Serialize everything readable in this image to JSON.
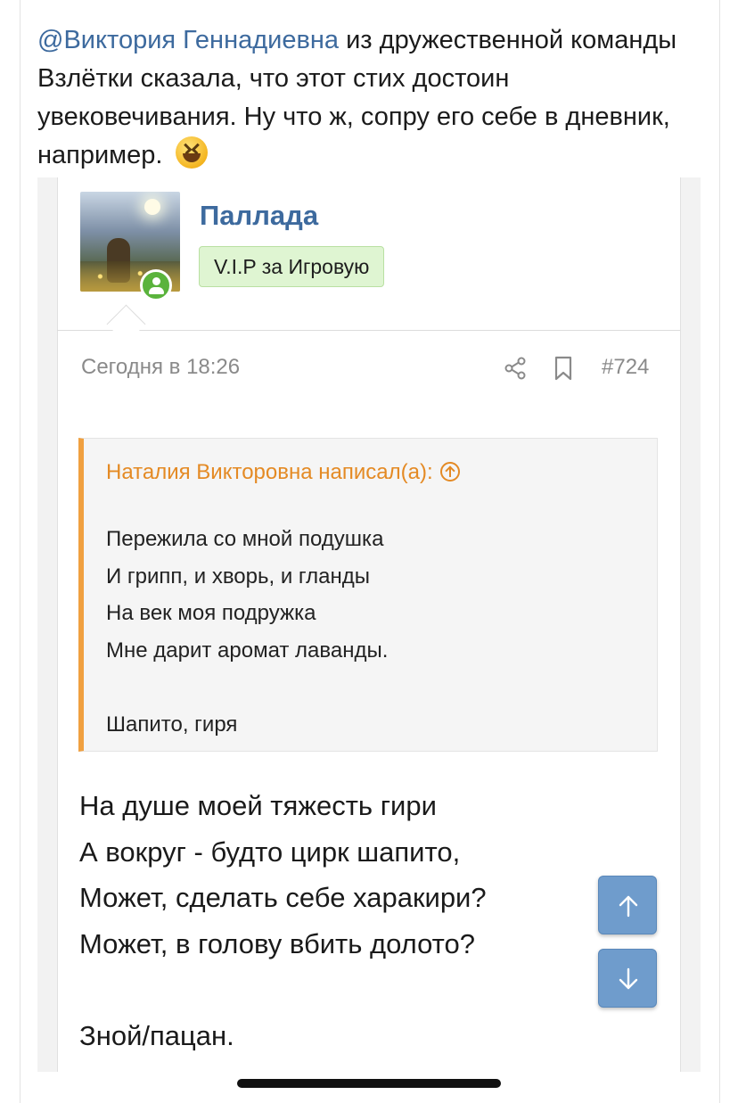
{
  "intro": {
    "mention": "@Виктория Геннадиевна",
    "text": " из дружественной команды Взлётки сказала, что этот стих достоин увековечивания. Ну что ж, сопру его себе в дневник, например.",
    "emoji": "grinning-squinting-face"
  },
  "post": {
    "username": "Паллада",
    "user_title": "V.I.P за Игровую",
    "date": "Сегодня в 18:26",
    "number": "#724",
    "quote": {
      "author": "Наталия Викторовна написал(а):",
      "lines": [
        "Пережила со мной подушка",
        "И грипп, и хворь, и гланды",
        "На век моя подружка",
        "Мне дарит аромат лаванды.",
        "",
        "Шапито, гиря"
      ]
    },
    "body_lines": [
      "На душе моей тяжесть гири",
      "А вокруг - будто цирк шапито,",
      "Может, сделать себе харакири?",
      "Может, в голову вбить долото?",
      "",
      "Зной/пацан."
    ]
  },
  "colors": {
    "link": "#3d6a9e",
    "quote_accent": "#f0a040",
    "badge_bg": "#dff5d2",
    "scroll_button": "#6f9ccc",
    "online": "#5ab33c"
  }
}
